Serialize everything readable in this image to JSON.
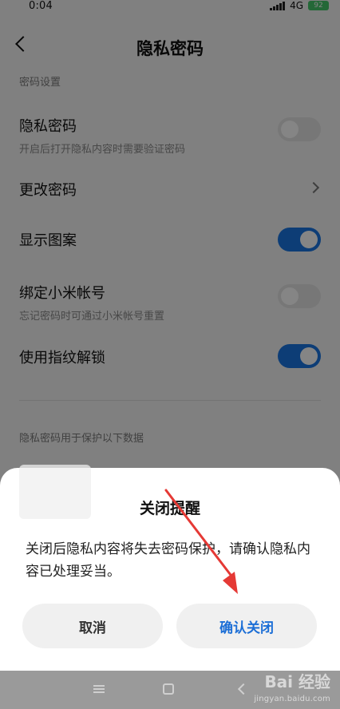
{
  "status_bar": {
    "time": "0:04",
    "network": "4G",
    "battery": "92"
  },
  "header": {
    "title": "隐私密码"
  },
  "sections": {
    "password_settings": "密码设置",
    "protected_data": "隐私密码用于保护以下数据"
  },
  "settings": [
    {
      "label": "隐私密码",
      "desc": "开启后打开隐私内容时需要验证密码",
      "control": "toggle",
      "state": "off"
    },
    {
      "label": "更改密码",
      "desc": "",
      "control": "chevron"
    },
    {
      "label": "显示图案",
      "desc": "",
      "control": "toggle",
      "state": "on"
    },
    {
      "label": "绑定小米帐号",
      "desc": "忘记密码时可通过小米帐号重置",
      "control": "toggle",
      "state": "off"
    },
    {
      "label": "使用指纹解锁",
      "desc": "",
      "control": "toggle",
      "state": "on"
    }
  ],
  "dialog": {
    "title": "关闭提醒",
    "body": "关闭后隐私内容将失去密码保护，请确认隐私内容已处理妥当。",
    "cancel_label": "取消",
    "confirm_label": "确认关闭"
  },
  "watermark": {
    "brand": "Bai 经验",
    "url": "jingyan.baidu.com"
  },
  "colors": {
    "accent": "#1976e3",
    "confirm_text": "#1b6ed6",
    "annotation_arrow": "#e53935"
  }
}
